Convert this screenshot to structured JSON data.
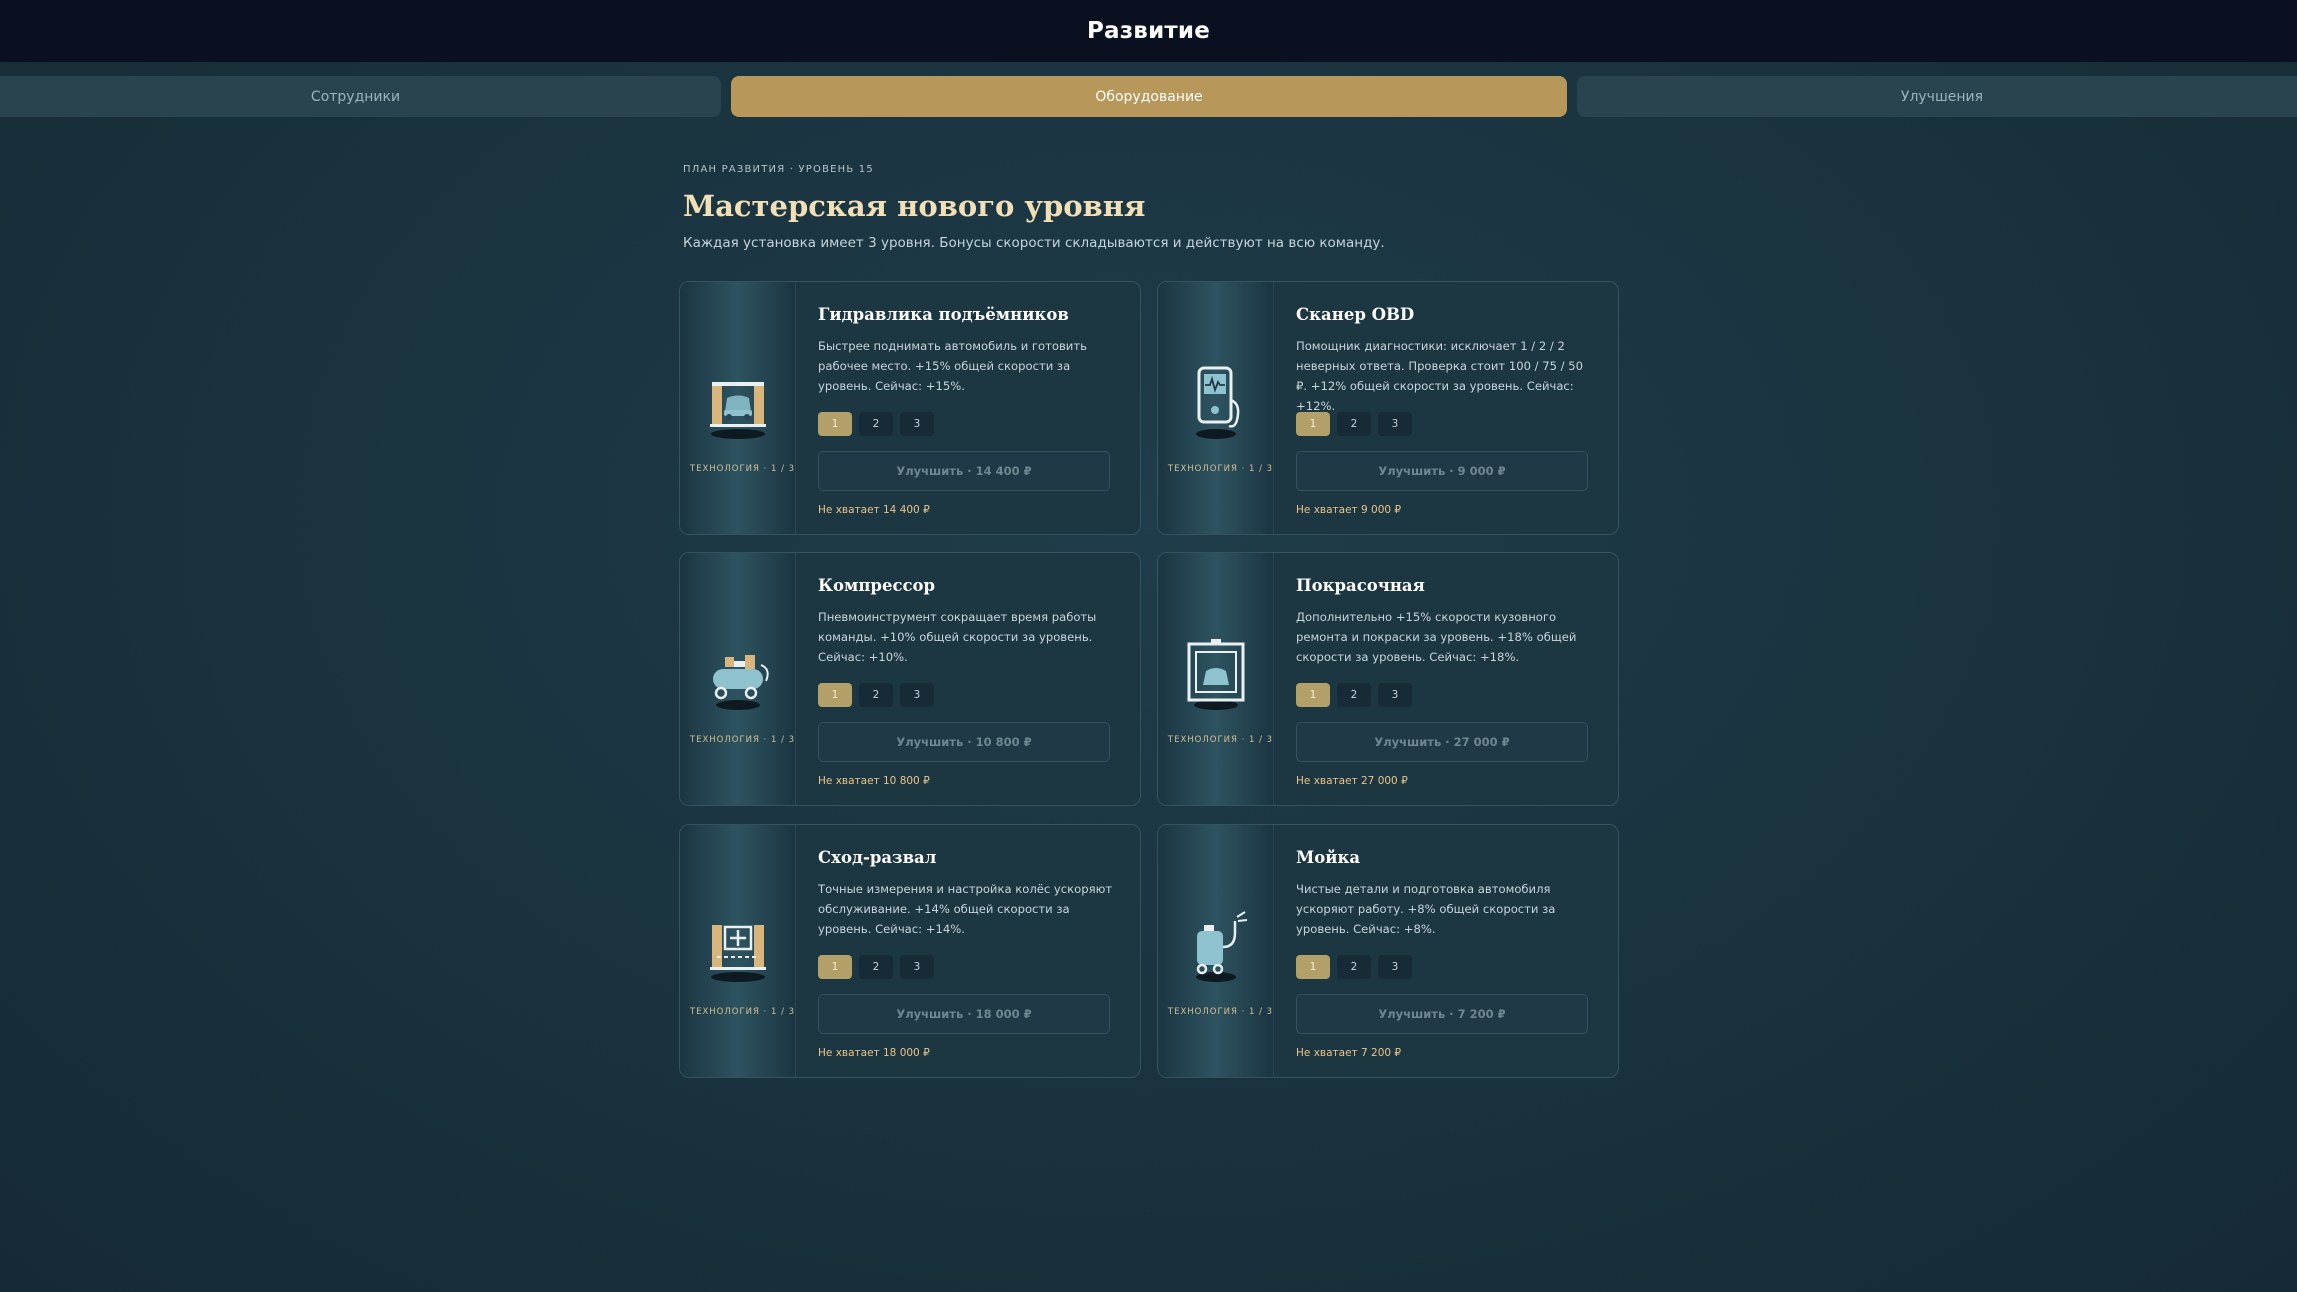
{
  "header": {
    "title": "Развитие"
  },
  "tabs": [
    {
      "label": "Сотрудники",
      "active": false
    },
    {
      "label": "Оборудование",
      "active": true
    },
    {
      "label": "Улучшения",
      "active": false
    }
  ],
  "hero": {
    "eyebrow": "ПЛАН РАЗВИТИЯ · УРОВЕНЬ 15",
    "title": "Мастерская нового уровня",
    "subtitle": "Каждая установка имеет 3 уровня. Бонусы скорости складываются и действуют на всю команду."
  },
  "colors": {
    "accent": "#b8975a",
    "heading": "#f3dfb6",
    "warning": "#e8c58a",
    "background": "#1a3440"
  },
  "cards": [
    {
      "title": "Гидравлика подъёмников",
      "icon": "car-lift-icon",
      "tech": "ТЕХНОЛОГИЯ · 1 / 3",
      "description": "Быстрее поднимать автомобиль и готовить рабочее место. +15% общей скорости за уровень. Сейчас: +15%.",
      "levels": [
        "1",
        "2",
        "3"
      ],
      "current_level": 1,
      "upgrade": "Улучшить · 14 400 ₽",
      "lack": "Не хватает 14 400 ₽"
    },
    {
      "title": "Сканер OBD",
      "icon": "obd-scanner-icon",
      "tech": "ТЕХНОЛОГИЯ · 1 / 3",
      "description": "Помощник диагностики: исключает 1 / 2 / 2 неверных ответа. Проверка стоит 100 / 75 / 50 ₽. +12% общей скорости за уровень. Сейчас: +12%.",
      "levels": [
        "1",
        "2",
        "3"
      ],
      "current_level": 1,
      "upgrade": "Улучшить · 9 000 ₽",
      "lack": "Не хватает 9 000 ₽"
    },
    {
      "title": "Компрессор",
      "icon": "compressor-icon",
      "tech": "ТЕХНОЛОГИЯ · 1 / 3",
      "description": "Пневмоинструмент сокращает время работы команды. +10% общей скорости за уровень. Сейчас: +10%.",
      "levels": [
        "1",
        "2",
        "3"
      ],
      "current_level": 1,
      "upgrade": "Улучшить · 10 800 ₽",
      "lack": "Не хватает 10 800 ₽"
    },
    {
      "title": "Покрасочная",
      "icon": "paint-booth-icon",
      "tech": "ТЕХНОЛОГИЯ · 1 / 3",
      "description": "Дополнительно +15% скорости кузовного ремонта и покраски за уровень. +18% общей скорости за уровень. Сейчас: +18%.",
      "levels": [
        "1",
        "2",
        "3"
      ],
      "current_level": 1,
      "upgrade": "Улучшить · 27 000 ₽",
      "lack": "Не хватает 27 000 ₽"
    },
    {
      "title": "Сход-развал",
      "icon": "wheel-alignment-icon",
      "tech": "ТЕХНОЛОГИЯ · 1 / 3",
      "description": "Точные измерения и настройка колёс ускоряют обслуживание. +14% общей скорости за уровень. Сейчас: +14%.",
      "levels": [
        "1",
        "2",
        "3"
      ],
      "current_level": 1,
      "upgrade": "Улучшить · 18 000 ₽",
      "lack": "Не хватает 18 000 ₽"
    },
    {
      "title": "Мойка",
      "icon": "car-wash-icon",
      "tech": "ТЕХНОЛОГИЯ · 1 / 3",
      "description": "Чистые детали и подготовка автомобиля ускоряют работу. +8% общей скорости за уровень. Сейчас: +8%.",
      "levels": [
        "1",
        "2",
        "3"
      ],
      "current_level": 1,
      "upgrade": "Улучшить · 7 200 ₽",
      "lack": "Не хватает 7 200 ₽"
    }
  ]
}
